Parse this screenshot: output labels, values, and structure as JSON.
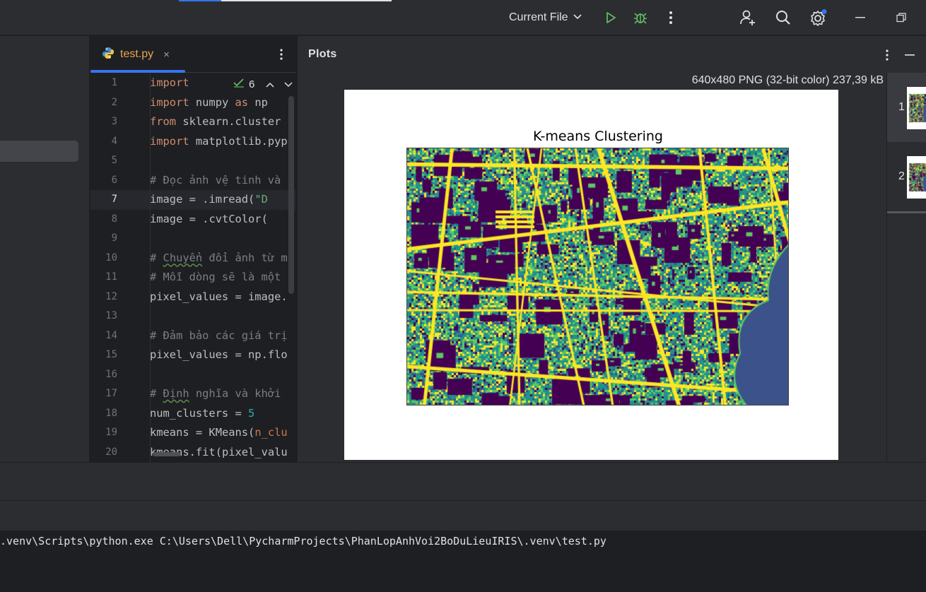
{
  "topbar": {
    "run_config": "Current File",
    "icons": [
      "chevron-down-icon",
      "run-icon",
      "debug-icon",
      "more-icon",
      "add-user-icon",
      "search-icon",
      "settings-icon",
      "minimize-icon",
      "restore-icon"
    ]
  },
  "editor": {
    "tab": {
      "label": "test.py",
      "close": "×"
    },
    "inspection_count": "6",
    "current_line": 7,
    "line_numbers": [
      "1",
      "2",
      "3",
      "4",
      "5",
      "6",
      "7",
      "8",
      "9",
      "10",
      "11",
      "12",
      "13",
      "14",
      "15",
      "16",
      "17",
      "18",
      "19",
      "20"
    ],
    "lines": [
      "import cv2",
      "import numpy as np",
      "from sklearn.cluster",
      "import matplotlib.pyp",
      "",
      "# Đọc ảnh vệ tinh và",
      "image = cv2.imread(\"D",
      "image = cv2.cvtColor(",
      "",
      "# Chuyển đổi ảnh từ m",
      "# Mỗi dòng sẽ là một",
      "pixel_values = image.",
      "",
      "# Đảm bảo các giá trị",
      "pixel_values = np.flo",
      "",
      "# Định nghĩa và khởi",
      "num_clusters = 5",
      "kmeans = KMeans(n_clu",
      "kmeans.fit(pixel_valu"
    ]
  },
  "plots": {
    "title": "Plots",
    "image_info": "640x480 PNG (32-bit color) 237,39 kB",
    "figure_title": "K-means Clustering",
    "thumbnails": [
      "1",
      "2"
    ]
  },
  "terminal": {
    "command": ".venv\\Scripts\\python.exe C:\\Users\\Dell\\PycharmProjects\\PhanLopAnhVoi2BoDuLieuIRIS\\.venv\\test.py"
  },
  "colors": {
    "accent": "#3574f0",
    "viridis_dark": "#440154",
    "viridis_blue": "#3b528b",
    "viridis_teal": "#21918c",
    "viridis_green": "#5ec962",
    "viridis_yellow": "#fde725"
  }
}
